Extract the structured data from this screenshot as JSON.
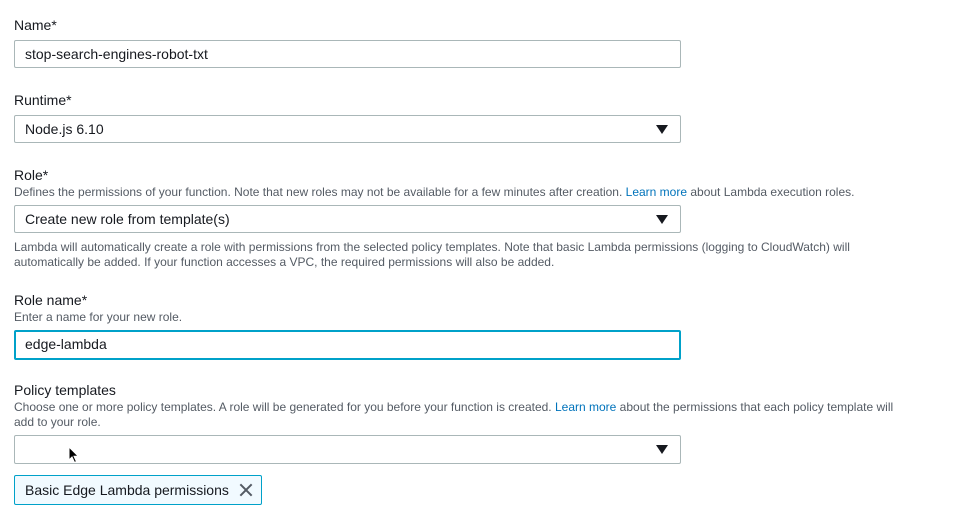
{
  "name": {
    "label": "Name*",
    "value": "stop-search-engines-robot-txt"
  },
  "runtime": {
    "label": "Runtime*",
    "value": "Node.js 6.10"
  },
  "role": {
    "label": "Role*",
    "desc_before": "Defines the permissions of your function. Note that new roles may not be available for a few minutes after creation. ",
    "desc_link": "Learn more",
    "desc_after": " about Lambda execution roles.",
    "value": "Create new role from template(s)",
    "help": "Lambda will automatically create a role with permissions from the selected policy templates. Note that basic Lambda permissions (logging to CloudWatch) will automatically be added. If your function accesses a VPC, the required permissions will also be added."
  },
  "role_name": {
    "label": "Role name*",
    "desc": "Enter a name for your new role.",
    "value": "edge-lambda"
  },
  "policy_templates": {
    "label": "Policy templates",
    "desc_before": "Choose one or more policy templates. A role will be generated for you before your function is created. ",
    "desc_link": "Learn more",
    "desc_after": " about the permissions that each policy template will add to your role.",
    "value": "",
    "selected_tokens": [
      "Basic Edge Lambda permissions"
    ]
  },
  "icons": {
    "dropdown": "caret-down-icon",
    "remove": "close-icon",
    "pointer": "mouse-pointer-icon"
  },
  "colors": {
    "link": "#0073bb",
    "focus_border": "#00a1c9",
    "token_background": "#f1faff"
  }
}
